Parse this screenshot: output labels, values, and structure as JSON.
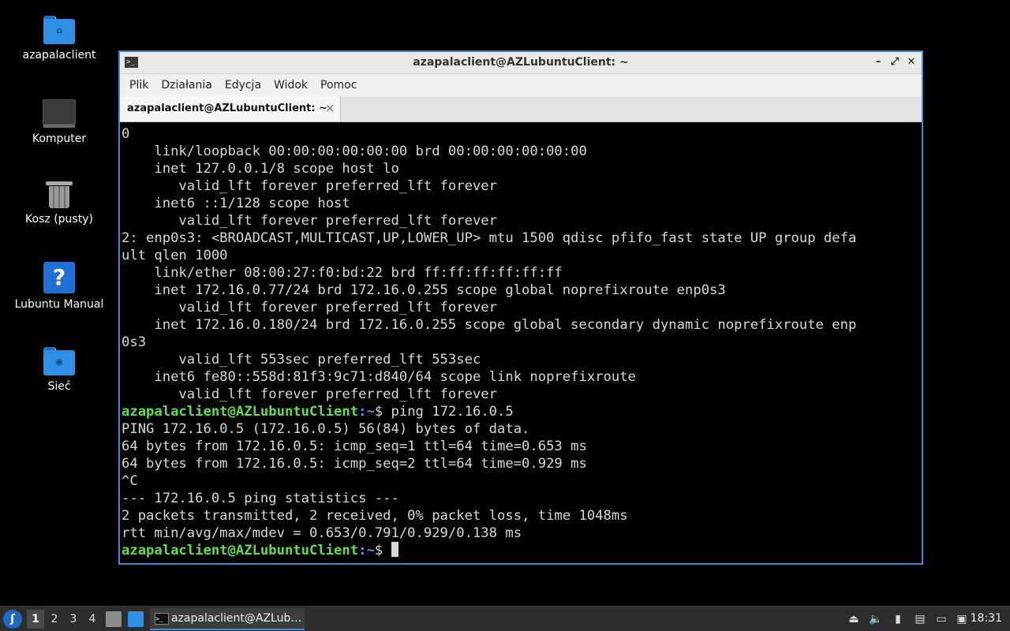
{
  "desktop": {
    "icons": [
      {
        "label": "azapalaclient",
        "icon": "home-folder-icon"
      },
      {
        "label": "Komputer",
        "icon": "computer-icon"
      },
      {
        "label": "Kosz (pusty)",
        "icon": "trash-icon"
      },
      {
        "label": "Lubuntu Manual",
        "icon": "help-icon"
      },
      {
        "label": "Sieć",
        "icon": "network-folder-icon"
      }
    ]
  },
  "window": {
    "title": "azapalaclient@AZLubuntuClient: ~",
    "controls": {
      "minimize": "–",
      "maximize": "⤢",
      "close": "✕"
    },
    "menu": [
      "Plik",
      "Działania",
      "Edycja",
      "Widok",
      "Pomoc"
    ],
    "tab": {
      "label": "azapalaclient@AZLubuntuClient: ~",
      "close": "×"
    }
  },
  "terminal": {
    "lines": [
      "0",
      "    link/loopback 00:00:00:00:00:00 brd 00:00:00:00:00:00",
      "    inet 127.0.0.1/8 scope host lo",
      "       valid_lft forever preferred_lft forever",
      "    inet6 ::1/128 scope host",
      "       valid_lft forever preferred_lft forever",
      "2: enp0s3: <BROADCAST,MULTICAST,UP,LOWER_UP> mtu 1500 qdisc pfifo_fast state UP group defa",
      "ult qlen 1000",
      "    link/ether 08:00:27:f0:bd:22 brd ff:ff:ff:ff:ff:ff",
      "    inet 172.16.0.77/24 brd 172.16.0.255 scope global noprefixroute enp0s3",
      "       valid_lft forever preferred_lft forever",
      "    inet 172.16.0.180/24 brd 172.16.0.255 scope global secondary dynamic noprefixroute enp",
      "0s3",
      "       valid_lft 553sec preferred_lft 553sec",
      "    inet6 fe80::558d:81f3:9c71:d840/64 scope link noprefixroute",
      "       valid_lft forever preferred_lft forever"
    ],
    "prompt_user": "azapalaclient@AZLubuntuClient",
    "prompt_path": ":~",
    "prompt_symbol": "$",
    "command": " ping 172.16.0.5",
    "output": [
      "PING 172.16.0.5 (172.16.0.5) 56(84) bytes of data.",
      "64 bytes from 172.16.0.5: icmp_seq=1 ttl=64 time=0.653 ms",
      "64 bytes from 172.16.0.5: icmp_seq=2 ttl=64 time=0.929 ms",
      "^C",
      "--- 172.16.0.5 ping statistics ---",
      "2 packets transmitted, 2 received, 0% packet loss, time 1048ms",
      "rtt min/avg/max/mdev = 0.653/0.791/0.929/0.138 ms"
    ]
  },
  "taskbar": {
    "workspaces": [
      "1",
      "2",
      "3",
      "4"
    ],
    "active_workspace": "1",
    "task_label": "azapalaclient@AZLub…",
    "clock": "18:31"
  },
  "colors": {
    "accent": "#3d88d8",
    "prompt": "#5ee04a",
    "path": "#6c8fe0"
  }
}
